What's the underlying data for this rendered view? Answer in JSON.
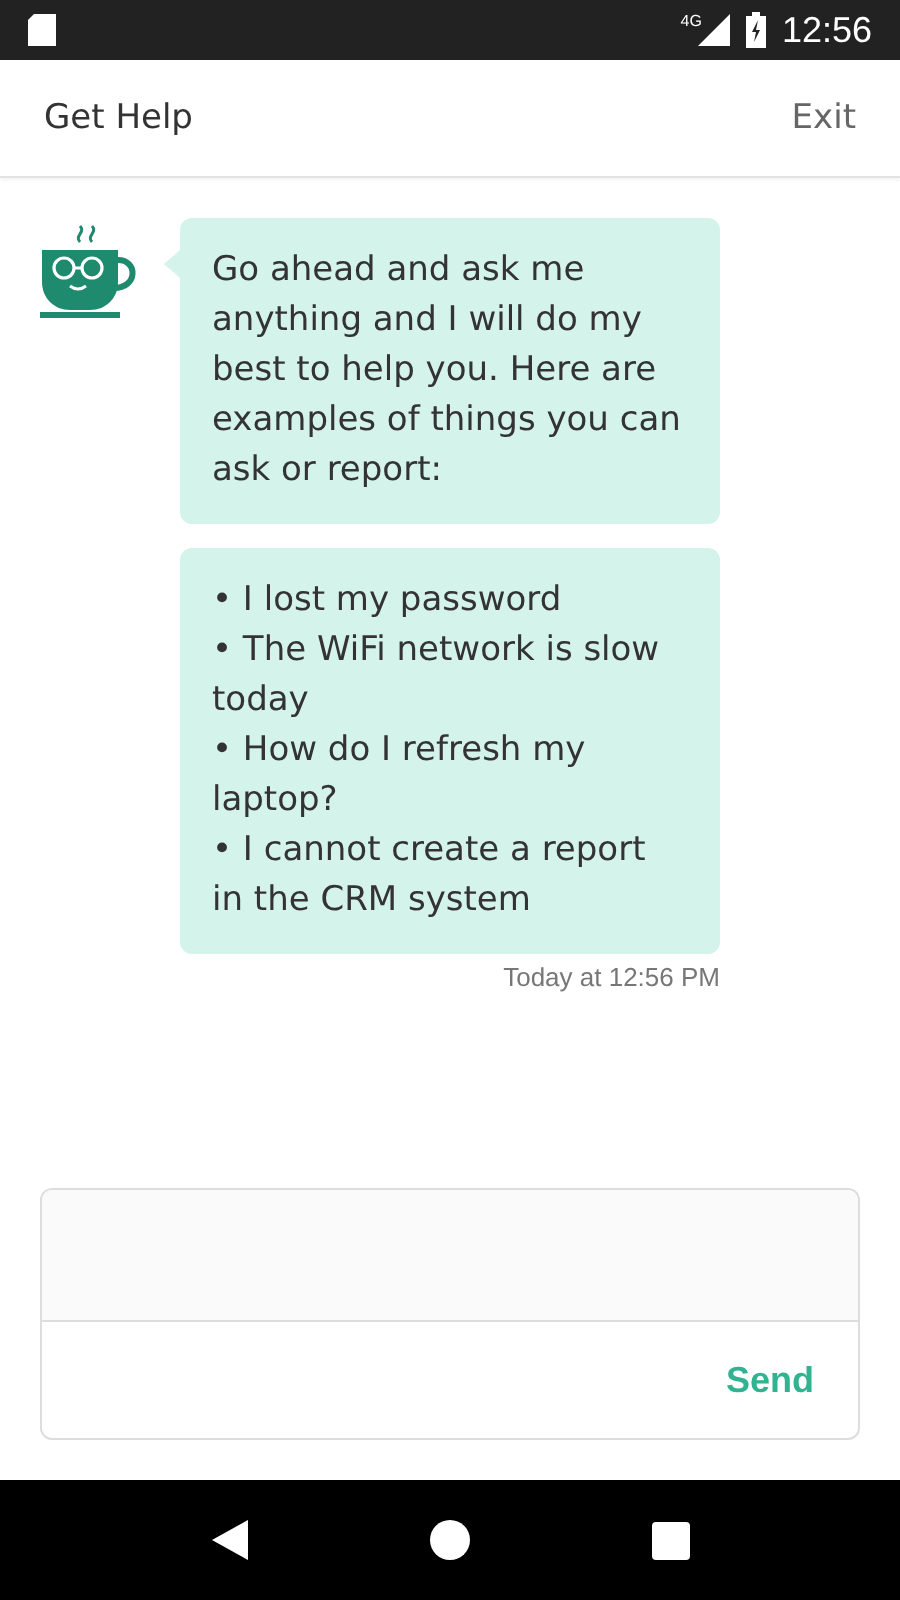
{
  "status_bar": {
    "network": "4G",
    "time": "12:56"
  },
  "header": {
    "title": "Get Help",
    "exit": "Exit"
  },
  "messages": [
    {
      "kind": "paragraph",
      "text": "Go ahead and ask me anything and I will do my best to help you. Here are examples of things you can ask or report:"
    },
    {
      "kind": "list",
      "items": [
        "• I lost my password",
        "• The WiFi network is slow today",
        "• How do I refresh my laptop?",
        "• I cannot create a report in the CRM system"
      ]
    }
  ],
  "timestamp": "Today at 12:56 PM",
  "composer": {
    "send": "Send"
  }
}
